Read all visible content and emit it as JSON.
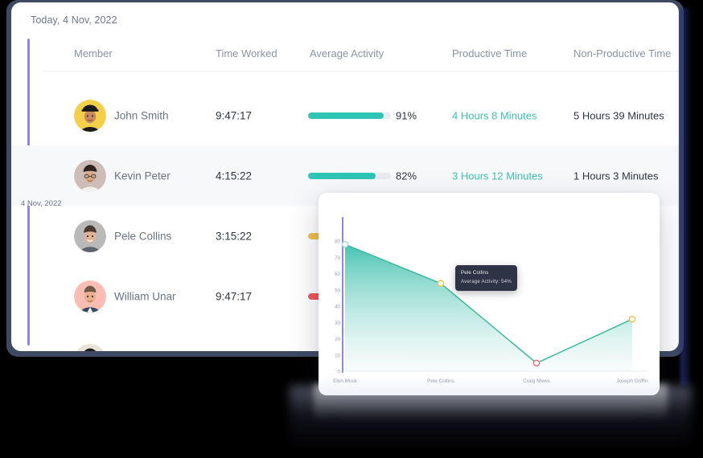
{
  "card": {
    "date_label": "Today, 4 Nov, 2022",
    "columns": [
      {
        "key": "member",
        "label": "Member"
      },
      {
        "key": "time_worked",
        "label": "Time Worked"
      },
      {
        "key": "average_activity",
        "label": "Average Activity"
      },
      {
        "key": "productive_time",
        "label": "Productive Time"
      },
      {
        "key": "non_productive_time",
        "label": "Non-Productive Time"
      }
    ],
    "rows": [
      {
        "member": "John Smith",
        "time_worked": "9:47:17",
        "activity_pct": "91%",
        "activity_value": 91,
        "bar_color": "#2ec4b6",
        "productive_time": "4 Hours 8 Minutes",
        "non_productive_time": "5 Hours 39 Minutes"
      },
      {
        "member": "Kevin Peter",
        "time_worked": "4:15:22",
        "activity_pct": "82%",
        "activity_value": 82,
        "bar_color": "#2ec4b6",
        "productive_time": "3 Hours 12 Minutes",
        "non_productive_time": "1 Hours 3 Minutes"
      },
      {
        "member": "Pele Collins",
        "time_worked": "3:15:22",
        "activity_pct": "",
        "activity_value": 54,
        "bar_color": "#f0c14b",
        "productive_time": "",
        "non_productive_time": ""
      },
      {
        "member": "William Unar",
        "time_worked": "9:47:17",
        "activity_pct": "",
        "activity_value": 26,
        "bar_color": "#f2555a",
        "productive_time": "",
        "non_productive_time": ""
      }
    ]
  },
  "chart_panel": {
    "date_label": "4 Nov, 2022",
    "tooltip": {
      "name": "Pele Collins",
      "value_label": "Average Activity: 54%"
    }
  },
  "chart_data": {
    "type": "area",
    "title": "4 Nov, 2022",
    "xlabel": "",
    "ylabel": "",
    "categories": [
      "Elon Musk",
      "Pele Collins",
      "Craig Mews",
      "Joseph Griffin"
    ],
    "values": [
      78,
      54,
      5,
      32
    ],
    "yticks": [
      0,
      10,
      20,
      30,
      40,
      50,
      60,
      70,
      80
    ],
    "ylim": [
      0,
      84
    ],
    "grid": false,
    "legend": "none",
    "series_name": "Average Activity",
    "line_color": "#3fb89e",
    "area_gradient": [
      "#3fc0ae",
      "#eaf7f4"
    ],
    "marker_colors": [
      "#9fd9cf",
      "#f0c14b",
      "#ef6a73",
      "#f0c14b"
    ],
    "annotations": [
      "Pele Collins — Average Activity: 54%"
    ]
  },
  "theme": {
    "accent_purple": "#8b86e8",
    "teal": "#2ec4b6",
    "yellow": "#f0c14b",
    "red": "#f2555a",
    "plate": "#3e4a63"
  }
}
